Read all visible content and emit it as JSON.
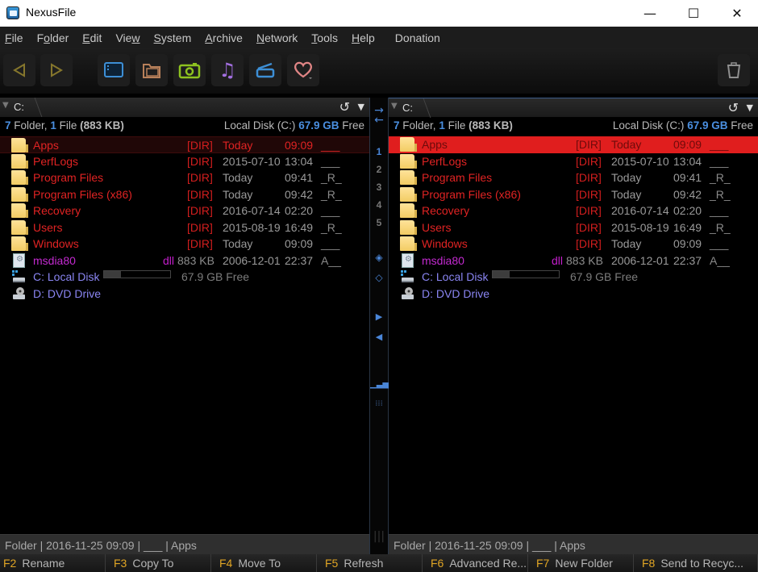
{
  "window": {
    "title": "NexusFile",
    "minimize": "—",
    "maximize": "☐",
    "close": "✕"
  },
  "menu": [
    "File",
    "Folder",
    "Edit",
    "View",
    "System",
    "Archive",
    "Network",
    "Tools",
    "Help",
    "Donation"
  ],
  "menu_underline": [
    "F",
    "o",
    "E",
    "w",
    "S",
    "A",
    "N",
    "T",
    "H",
    ""
  ],
  "toolbar": {
    "buttons": [
      {
        "name": "back",
        "icon": "◁",
        "color": "#8a7a2e"
      },
      {
        "name": "forward",
        "icon": "▷",
        "color": "#8a7a2e"
      },
      {
        "name": "desktop",
        "icon": "desktop-icon",
        "color": "#3d8fd6"
      },
      {
        "name": "documents",
        "icon": "folder-icon",
        "color": "#c08552"
      },
      {
        "name": "pictures",
        "icon": "camera-icon",
        "color": "#8dc21f"
      },
      {
        "name": "music",
        "icon": "♫",
        "color": "#a36fe0"
      },
      {
        "name": "scanner",
        "icon": "scanner-icon",
        "color": "#3d8fd6"
      },
      {
        "name": "favorites",
        "icon": "♡",
        "color": "#e08a8a"
      },
      {
        "name": "recycle-bin",
        "icon": "trash-icon",
        "color": "#9a9a9a"
      }
    ]
  },
  "left": {
    "path": "C:",
    "summary": {
      "folders": "7",
      "folder_label": "Folder,",
      "files": "1",
      "file_label": "File",
      "size": "(883 KB)"
    },
    "disk": {
      "label": "Local Disk (C:)",
      "free": "67.9 GB",
      "free_label": "Free"
    },
    "status": "Folder  |  2016-11-25 09:09  |  ___  |  Apps"
  },
  "right": {
    "path": "C:",
    "summary": {
      "folders": "7",
      "folder_label": "Folder,",
      "files": "1",
      "file_label": "File",
      "size": "(883 KB)"
    },
    "disk": {
      "label": "Local Disk (C:)",
      "free": "67.9 GB",
      "free_label": "Free"
    },
    "status": "Folder  |  2016-11-25 09:09  |  ___  |  Apps"
  },
  "entries": [
    {
      "type": "dir",
      "name": "Apps",
      "tag": "[DIR]",
      "date": "Today",
      "time": "09:09",
      "attr": "___"
    },
    {
      "type": "dir",
      "name": "PerfLogs",
      "tag": "[DIR]",
      "date": "2015-07-10",
      "time": "13:04",
      "attr": "___"
    },
    {
      "type": "dir",
      "name": "Program Files",
      "tag": "[DIR]",
      "date": "Today",
      "time": "09:41",
      "attr": "_R_"
    },
    {
      "type": "dir",
      "name": "Program Files (x86)",
      "tag": "[DIR]",
      "date": "Today",
      "time": "09:42",
      "attr": "_R_"
    },
    {
      "type": "dir",
      "name": "Recovery",
      "tag": "[DIR]",
      "date": "2016-07-14",
      "time": "02:20",
      "attr": "___"
    },
    {
      "type": "dir",
      "name": "Users",
      "tag": "[DIR]",
      "date": "2015-08-19",
      "time": "16:49",
      "attr": "_R_"
    },
    {
      "type": "dir",
      "name": "Windows",
      "tag": "[DIR]",
      "date": "Today",
      "time": "09:09",
      "attr": "___"
    },
    {
      "type": "file",
      "name": "msdia80",
      "ext": "dll",
      "size": "883 KB",
      "date": "2006-12-01",
      "time": "22:37",
      "attr": "A__"
    }
  ],
  "drives": [
    {
      "name": "C: Local Disk",
      "used_fraction": 0.25,
      "free": "67.9 GB Free",
      "icon": "hard-disk-icon"
    },
    {
      "name": "D: DVD Drive",
      "icon": "dvd-drive-icon"
    }
  ],
  "middle": {
    "numbers": [
      "1",
      "2",
      "3",
      "4",
      "5"
    ]
  },
  "fkeys": [
    {
      "key": "F2",
      "label": "Rename"
    },
    {
      "key": "F3",
      "label": "Copy To"
    },
    {
      "key": "F4",
      "label": "Move To"
    },
    {
      "key": "F5",
      "label": "Refresh"
    },
    {
      "key": "F6",
      "label": "Advanced Re..."
    },
    {
      "key": "F7",
      "label": "New Folder"
    },
    {
      "key": "F8",
      "label": "Send to Recyc..."
    }
  ]
}
